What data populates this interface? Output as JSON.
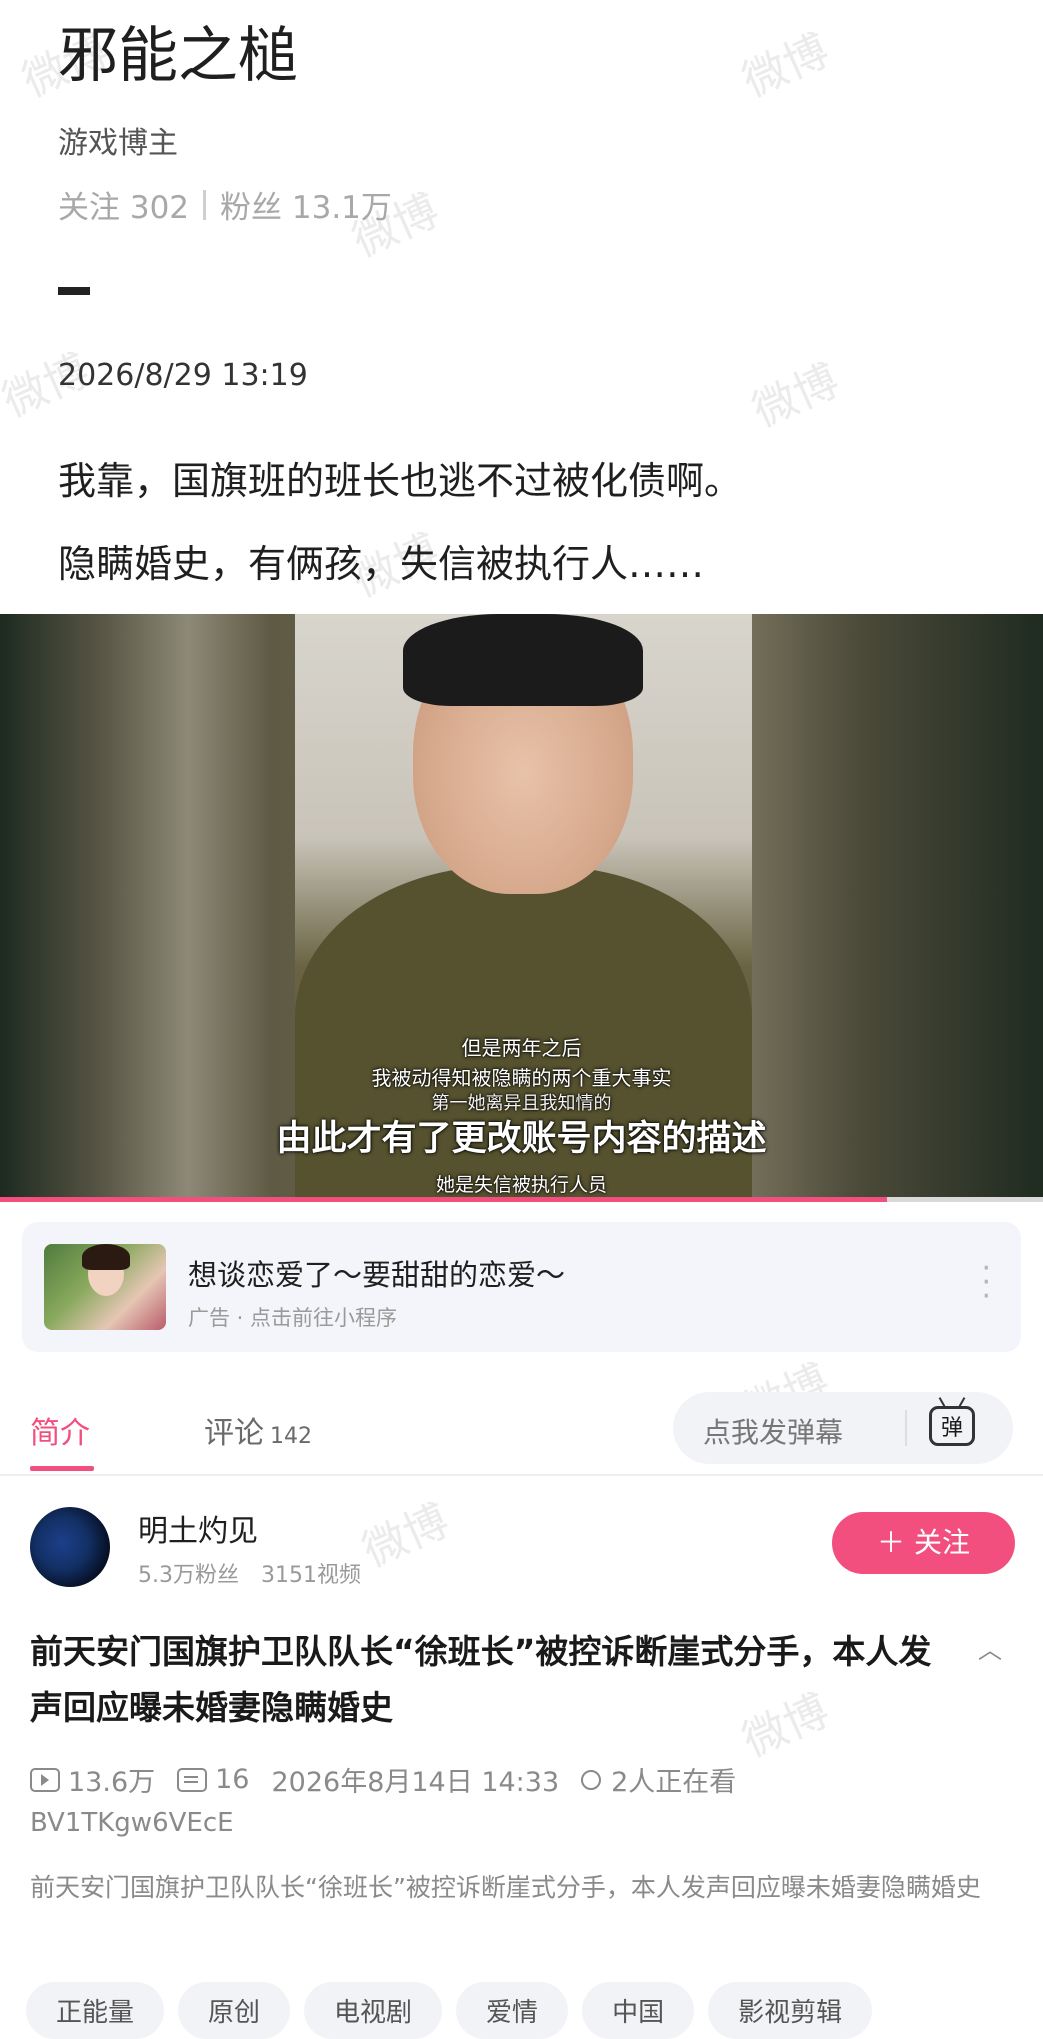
{
  "post": {
    "author_name": "邪能之槌",
    "author_role": "游戏博主",
    "following_label": "关注 302",
    "followers_label": "粉丝 13.1万",
    "datetime": "2026/8/29 13:19",
    "text_line1": "我靠，国旗班的班长也逃不过被化债啊。",
    "text_line2": "隐瞒婚史，有俩孩，失信被执行人……",
    "watermark": "微博"
  },
  "video": {
    "subtitle_line1": "但是两年之后",
    "subtitle_line2": "我被动得知被隐瞒的两个重大事实",
    "subtitle_line3": "第一她离异且我知情的",
    "subtitle_main": "由此才有了更改账号内容的描述",
    "subtitle_line5": "她是失信被执行人员",
    "progress_fraction": 0.85
  },
  "ad": {
    "title": "想谈恋爱了～要甜甜的恋爱～",
    "subtitle": "广告 · 点击前往小程序",
    "more_icon": "more-vertical-icon"
  },
  "tabs": {
    "intro_label": "简介",
    "comments_label": "评论",
    "comments_count": "142",
    "danmaku_placeholder": "点我发弹幕",
    "danmaku_icon_text": "弹"
  },
  "uploader": {
    "name": "明土灼见",
    "stats": "5.3万粉丝　3151视频",
    "follow_label": "＋ 关注"
  },
  "video_info": {
    "title": "前天安门国旗护卫队队长“徐班长”被控诉断崖式分手，本人发声回应曝未婚妻隐瞒婚史",
    "collapse_icon": "chevron-up-icon",
    "views": "13.6万",
    "danmaku_count": "16",
    "publish_time": "2026年8月14日 14:33",
    "watching": "2人正在看",
    "bvid": "BV1TKgw6VEcE",
    "description": "前天安门国旗护卫队队长“徐班长”被控诉断崖式分手，本人发声回应曝未婚妻隐瞒婚史",
    "tags": [
      "正能量",
      "原创",
      "电视剧",
      "爱情",
      "中国",
      "影视剪辑"
    ]
  },
  "colors": {
    "accent": "#f24f7f",
    "muted": "#8a8a8a"
  }
}
